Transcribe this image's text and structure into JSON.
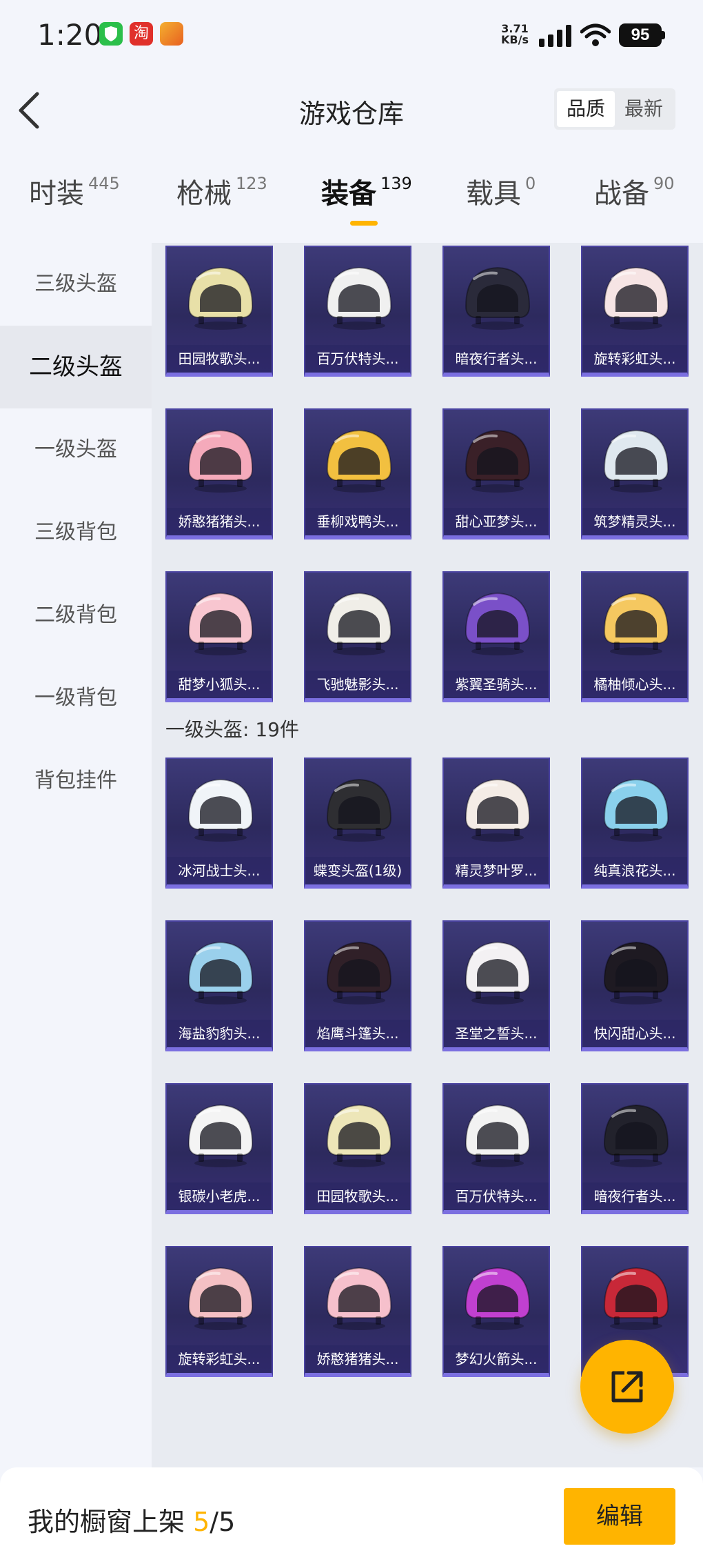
{
  "status_bar": {
    "time": "1:20",
    "net_speed_value": "3.71",
    "net_speed_unit": "KB/s",
    "battery": "95",
    "app_icons": [
      "shield-app-icon",
      "taobao-app-icon",
      "game-app-icon"
    ],
    "app_icon_text": "淘"
  },
  "header": {
    "title": "游戏仓库",
    "sort_options": [
      "品质",
      "最新"
    ],
    "sort_selected": "品质"
  },
  "tabs": [
    {
      "label": "时装",
      "count": "445"
    },
    {
      "label": "枪械",
      "count": "123"
    },
    {
      "label": "装备",
      "count": "139"
    },
    {
      "label": "载具",
      "count": "0"
    },
    {
      "label": "战备",
      "count": "90"
    }
  ],
  "active_tab": "装备",
  "sidebar": {
    "items": [
      "三级头盔",
      "二级头盔",
      "一级头盔",
      "三级背包",
      "二级背包",
      "一级背包",
      "背包挂件"
    ],
    "active": "二级头盔"
  },
  "sections": {
    "level1_helmet_header": "一级头盔: 19件"
  },
  "level2_items": [
    "田园牧歌头...",
    "百万伏特头...",
    "暗夜行者头...",
    "旋转彩虹头...",
    "娇憨猪猪头...",
    "垂柳戏鸭头...",
    "甜心亚梦头...",
    "筑梦精灵头...",
    "甜梦小狐头...",
    "飞驰魅影头...",
    "紫翼圣骑头...",
    "橘柚倾心头..."
  ],
  "level1_items": [
    "冰河战士头...",
    "蝶变头盔(1级)",
    "精灵梦叶罗...",
    "纯真浪花头...",
    "海盐豹豹头...",
    "焰鹰斗篷头...",
    "圣堂之誓头...",
    "快闪甜心头...",
    "银碳小老虎...",
    "田园牧歌头...",
    "百万伏特头...",
    "暗夜行者头...",
    "旋转彩虹头...",
    "娇憨猪猪头...",
    "梦幻火箭头...",
    ""
  ],
  "bottom_bar": {
    "label": "我的橱窗上架",
    "used": "5",
    "separator": "/",
    "total": "5",
    "edit_label": "编辑"
  },
  "colors": {
    "accent": "#ffb400",
    "card_bg": "#2d2a5e",
    "card_border": "#7b6fe0"
  },
  "helmet_colors_level2": [
    "#e8e0a8",
    "#f0f0f0",
    "#2a2a3a",
    "#f6e4e4",
    "#f5aabb",
    "#f2c040",
    "#3a2028",
    "#dfe8ef",
    "#f8c6d0",
    "#f0eee8",
    "#7a50c8",
    "#f5c860"
  ],
  "helmet_colors_level1": [
    "#f0f4f8",
    "#2e2e32",
    "#f4ece6",
    "#8ad0ec",
    "#9ad0ec",
    "#302028",
    "#f3f1f3",
    "#1e1a22",
    "#f4f4f4",
    "#ede6b8",
    "#f2f2f2",
    "#22222c",
    "#f4c0c4",
    "#f6c0cc",
    "#c040d0",
    "#c82838"
  ]
}
